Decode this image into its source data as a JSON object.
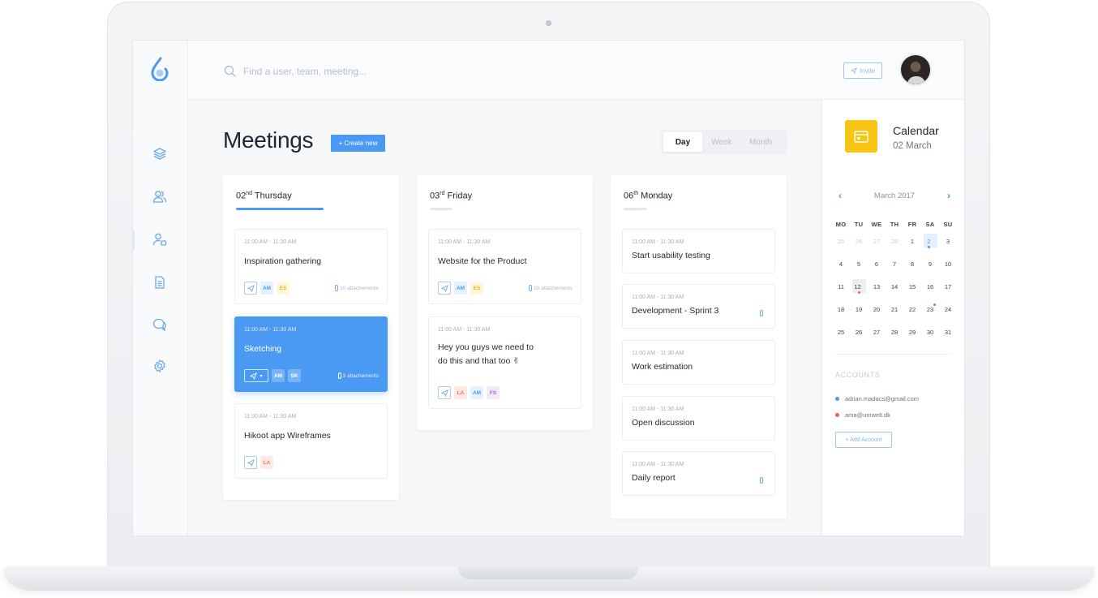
{
  "search": {
    "placeholder": "Find a user, team, meeting..."
  },
  "header": {
    "invite_label": "Invite"
  },
  "main": {
    "title": "Meetings",
    "create_label": "+ Create new",
    "views": [
      "Day",
      "Week",
      "Month"
    ],
    "active_view": "Day"
  },
  "days": [
    {
      "num": "02",
      "suffix": "nd",
      "name": "Thursday",
      "meetings": [
        {
          "time": "11:00 AM - 11:30 AM",
          "title": "Inspiration gathering",
          "tags": [
            "AM",
            "ES"
          ],
          "attachments": "10 attachements"
        },
        {
          "time": "11:00 AM - 11:30 AM",
          "title": "Sketching",
          "tags": [
            "AM",
            "SK"
          ],
          "attachments": "3 attachements"
        },
        {
          "time": "11:00 AM - 11:30 AM",
          "title": "Hikoot app Wireframes",
          "tags": [
            "LA"
          ]
        }
      ]
    },
    {
      "num": "03",
      "suffix": "rd",
      "name": "Friday",
      "meetings": [
        {
          "time": "11:00 AM - 11:30 AM",
          "title": "Website for the Product",
          "tags": [
            "AM",
            "ES"
          ],
          "attachments": "10 attachements"
        },
        {
          "time": "11:00 AM - 11:30 AM",
          "title_line1": "Hey you guys we need to",
          "title_line2": "do this and that too ✌",
          "tags": [
            "LA",
            "AM",
            "FS"
          ]
        }
      ]
    },
    {
      "num": "06",
      "suffix": "th",
      "name": "Monday",
      "meetings": [
        {
          "time": "11:00 AM - 11:30 AM",
          "title": "Start usability testing"
        },
        {
          "time": "11:00 AM - 11:30 AM",
          "title": "Development - Sprint 3"
        },
        {
          "time": "11:00 AM - 11:30 AM",
          "title": "Work estimation"
        },
        {
          "time": "11:00 AM - 11:30 AM",
          "title": "Open discussion"
        },
        {
          "time": "11:00 AM - 11:30 AM",
          "title": "Daily report"
        }
      ]
    }
  ],
  "calendar": {
    "heading": "Calendar",
    "subheading": "02 March",
    "month_label": "March 2017",
    "weekdays": [
      "MO",
      "TU",
      "WE",
      "TH",
      "FR",
      "SA",
      "SU"
    ],
    "weeks": [
      [
        "25",
        "26",
        "27",
        "28",
        "1",
        "2",
        "3"
      ],
      [
        "4",
        "5",
        "6",
        "7",
        "8",
        "9",
        "10"
      ],
      [
        "11",
        "12",
        "13",
        "14",
        "15",
        "16",
        "17"
      ],
      [
        "18",
        "19",
        "20",
        "21",
        "22",
        "23",
        "24"
      ],
      [
        "25",
        "26",
        "27",
        "28",
        "29",
        "30",
        "31"
      ]
    ],
    "selected_day": "2",
    "today_day": "12"
  },
  "accounts": {
    "label": "ACCOUNTS",
    "items": [
      {
        "email": "adrian.madacs@gmail.com",
        "color": "#4a9af4"
      },
      {
        "email": "ama@umwelt.dk",
        "color": "#f0634c"
      }
    ],
    "add_label": "+ Add Account"
  },
  "colors": {
    "accent": "#4a9af4",
    "calendar_tile": "#f8c512"
  }
}
